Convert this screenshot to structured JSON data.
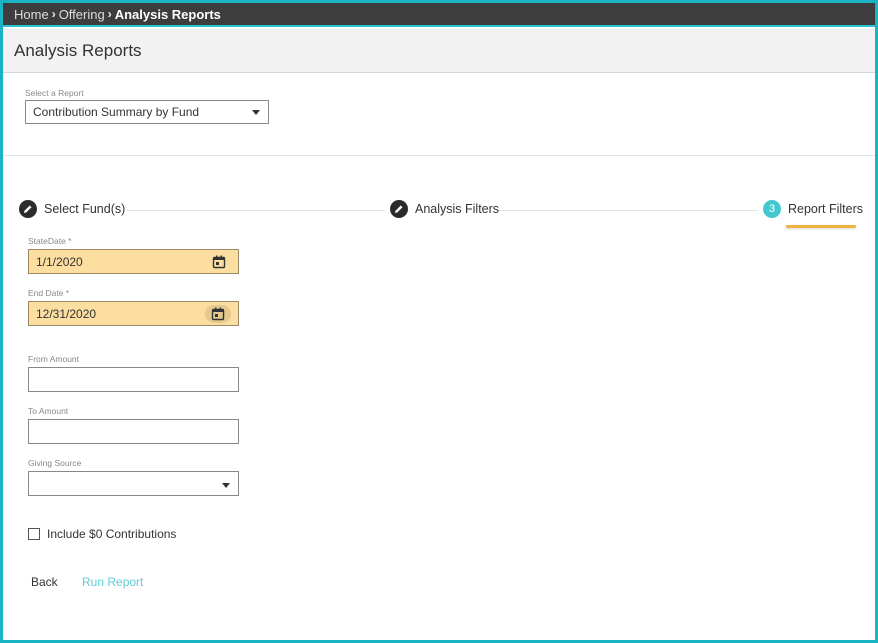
{
  "breadcrumb": {
    "items": [
      {
        "label": "Home"
      },
      {
        "label": "Offering"
      },
      {
        "label": "Analysis Reports"
      }
    ]
  },
  "header": {
    "title": "Analysis Reports"
  },
  "report_selector": {
    "label": "Select a Report",
    "value": "Contribution Summary by Fund"
  },
  "stepper": {
    "steps": [
      {
        "label": "Select Fund(s)",
        "state": "completed",
        "icon": "pencil-icon"
      },
      {
        "label": "Analysis Filters",
        "state": "completed",
        "icon": "pencil-icon"
      },
      {
        "label": "Report Filters",
        "state": "active",
        "number": "3"
      }
    ],
    "active_color": "#44c8d0",
    "underline_color": "#f0b340"
  },
  "form": {
    "start_date": {
      "label": "StateDate *",
      "value": "1/1/2020"
    },
    "end_date": {
      "label": "End Date *",
      "value": "12/31/2020"
    },
    "from_amount": {
      "label": "From Amount",
      "value": ""
    },
    "to_amount": {
      "label": "To Amount",
      "value": ""
    },
    "giving_source": {
      "label": "Giving Source",
      "value": ""
    },
    "include_zero": {
      "label": "Include $0 Contributions",
      "checked": false
    },
    "date_field_color": "#fbdea0"
  },
  "actions": {
    "back_label": "Back",
    "run_label": "Run Report",
    "run_color": "#5ecdd4"
  }
}
